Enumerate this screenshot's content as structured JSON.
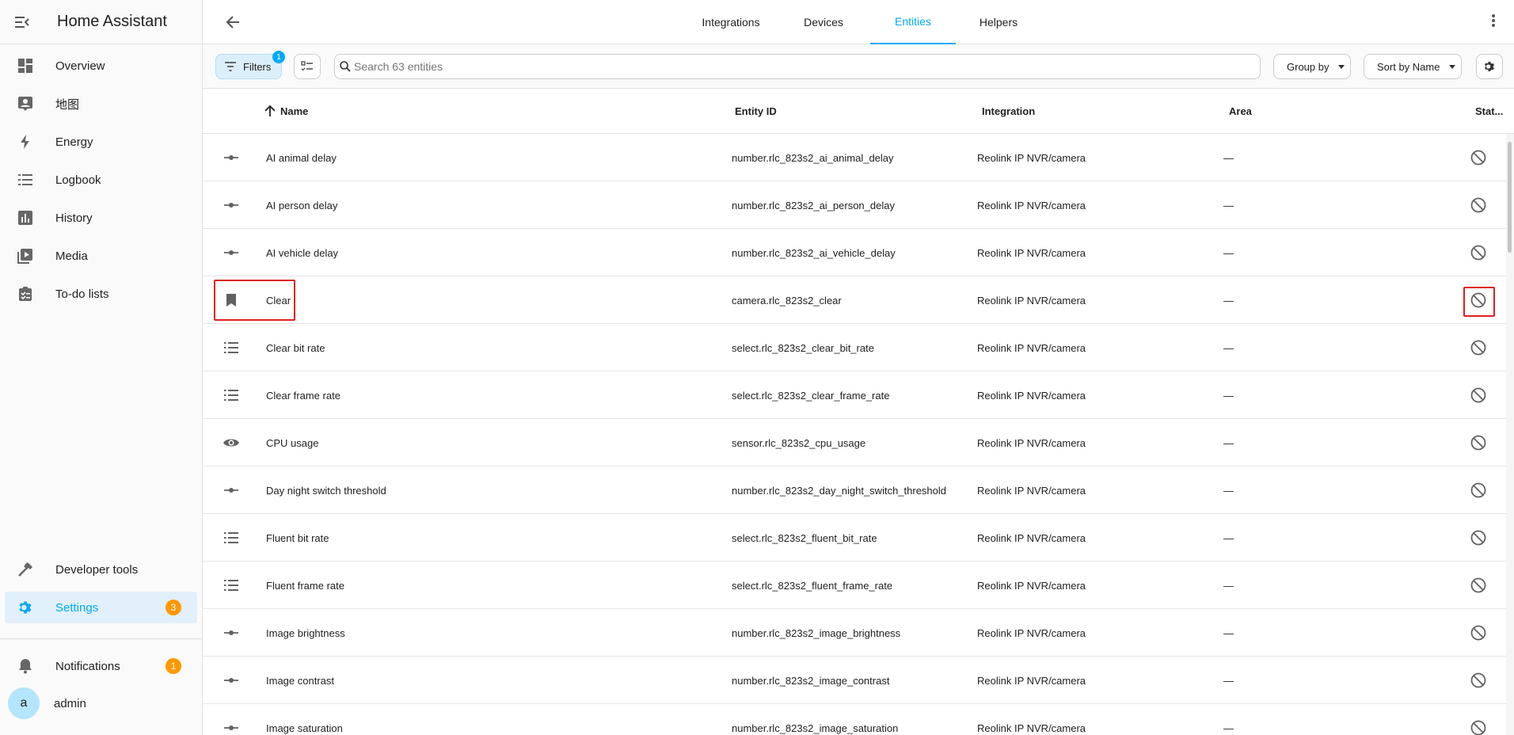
{
  "app": {
    "title": "Home Assistant"
  },
  "sidebar": {
    "items": [
      {
        "label": "Overview",
        "icon": "dashboard-icon"
      },
      {
        "label": "地图",
        "icon": "map-icon"
      },
      {
        "label": "Energy",
        "icon": "lightning-icon"
      },
      {
        "label": "Logbook",
        "icon": "list-icon"
      },
      {
        "label": "History",
        "icon": "chart-icon"
      },
      {
        "label": "Media",
        "icon": "media-icon"
      },
      {
        "label": "To-do lists",
        "icon": "clipboard-icon"
      }
    ],
    "developer_tools": "Developer tools",
    "settings": "Settings",
    "settings_badge": "3",
    "notifications": "Notifications",
    "notifications_badge": "1",
    "user": "admin",
    "user_initial": "a"
  },
  "tabs": [
    "Integrations",
    "Devices",
    "Entities",
    "Helpers"
  ],
  "active_tab": "Entities",
  "toolbar": {
    "filters_label": "Filters",
    "filters_count": "1",
    "search_placeholder": "Search 63 entities",
    "group_by": "Group by",
    "sort_by": "Sort by Name"
  },
  "table": {
    "headers": {
      "name": "Name",
      "entity_id": "Entity ID",
      "integration": "Integration",
      "area": "Area",
      "status": "Stat..."
    },
    "rows": [
      {
        "icon": "slider-icon",
        "name": "AI animal delay",
        "entity_id": "number.rlc_823s2_ai_animal_delay",
        "integration": "Reolink IP NVR/camera",
        "area": "—"
      },
      {
        "icon": "slider-icon",
        "name": "AI person delay",
        "entity_id": "number.rlc_823s2_ai_person_delay",
        "integration": "Reolink IP NVR/camera",
        "area": "—"
      },
      {
        "icon": "slider-icon",
        "name": "AI vehicle delay",
        "entity_id": "number.rlc_823s2_ai_vehicle_delay",
        "integration": "Reolink IP NVR/camera",
        "area": "—"
      },
      {
        "icon": "bookmark-icon",
        "name": "Clear",
        "entity_id": "camera.rlc_823s2_clear",
        "integration": "Reolink IP NVR/camera",
        "area": "—"
      },
      {
        "icon": "list-icon",
        "name": "Clear bit rate",
        "entity_id": "select.rlc_823s2_clear_bit_rate",
        "integration": "Reolink IP NVR/camera",
        "area": "—"
      },
      {
        "icon": "list-icon",
        "name": "Clear frame rate",
        "entity_id": "select.rlc_823s2_clear_frame_rate",
        "integration": "Reolink IP NVR/camera",
        "area": "—"
      },
      {
        "icon": "eye-icon",
        "name": "CPU usage",
        "entity_id": "sensor.rlc_823s2_cpu_usage",
        "integration": "Reolink IP NVR/camera",
        "area": "—"
      },
      {
        "icon": "slider-icon",
        "name": "Day night switch threshold",
        "entity_id": "number.rlc_823s2_day_night_switch_threshold",
        "integration": "Reolink IP NVR/camera",
        "area": "—"
      },
      {
        "icon": "list-icon",
        "name": "Fluent bit rate",
        "entity_id": "select.rlc_823s2_fluent_bit_rate",
        "integration": "Reolink IP NVR/camera",
        "area": "—"
      },
      {
        "icon": "list-icon",
        "name": "Fluent frame rate",
        "entity_id": "select.rlc_823s2_fluent_frame_rate",
        "integration": "Reolink IP NVR/camera",
        "area": "—"
      },
      {
        "icon": "slider-icon",
        "name": "Image brightness",
        "entity_id": "number.rlc_823s2_image_brightness",
        "integration": "Reolink IP NVR/camera",
        "area": "—"
      },
      {
        "icon": "slider-icon",
        "name": "Image contrast",
        "entity_id": "number.rlc_823s2_image_contrast",
        "integration": "Reolink IP NVR/camera",
        "area": "—"
      },
      {
        "icon": "slider-icon",
        "name": "Image saturation",
        "entity_id": "number.rlc_823s2_image_saturation",
        "integration": "Reolink IP NVR/camera",
        "area": "—"
      }
    ]
  },
  "colors": {
    "accent": "#03a9f4",
    "badge": "#ff9800",
    "highlight": "#e02020"
  }
}
